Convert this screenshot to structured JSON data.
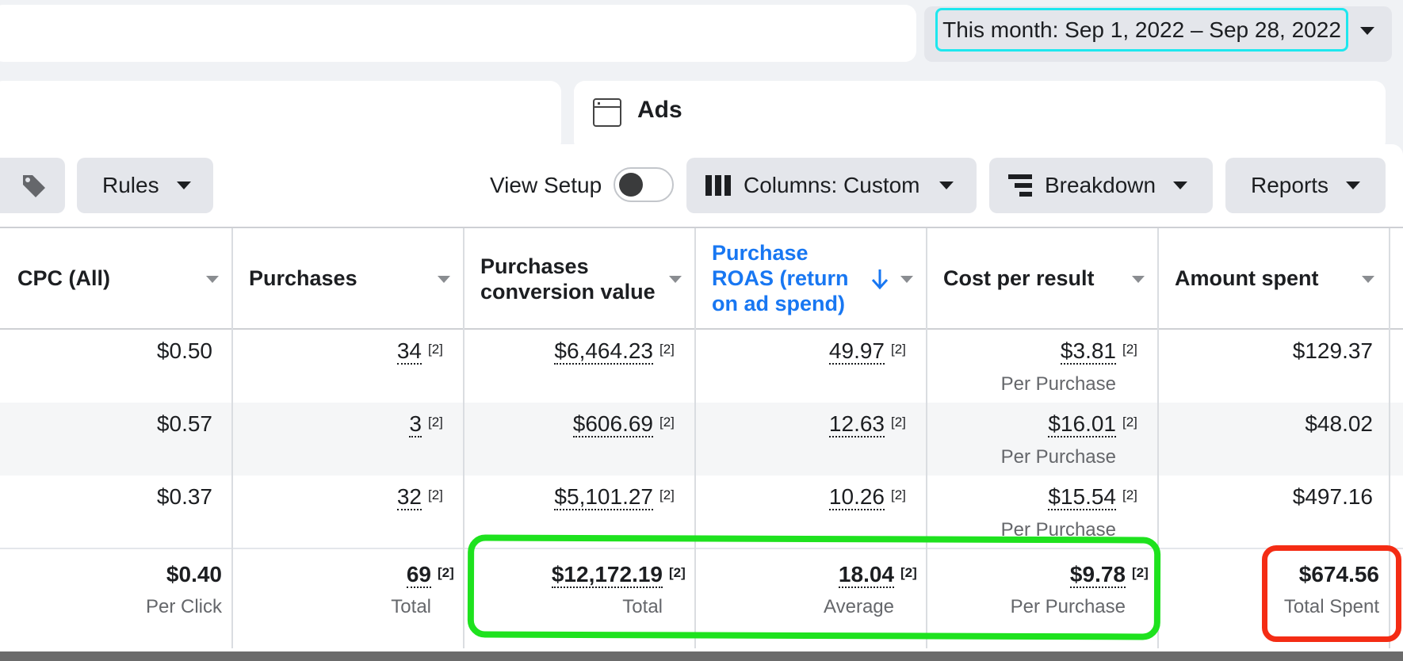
{
  "date_range": {
    "label": "This month: Sep 1, 2022 – Sep 28, 2022"
  },
  "ads_panel": {
    "title": "Ads",
    "icon": "window-icon"
  },
  "toolbar": {
    "rules_label": "Rules",
    "view_setup_label": "View Setup",
    "columns_label": "Columns: Custom",
    "breakdown_label": "Breakdown",
    "reports_label": "Reports"
  },
  "table": {
    "headers": {
      "cpc": "CPC (All)",
      "purchases": "Purchases",
      "conv_value_1": "Purchases",
      "conv_value_2": "conversion value",
      "roas_1": "Purchase",
      "roas_2": "ROAS (return",
      "roas_3": "on ad spend)",
      "cost_per_result": "Cost per result",
      "amount_spent": "Amount spent"
    },
    "note_marker": "[2]",
    "rows": [
      {
        "cpc": "$0.50",
        "purchases": "34",
        "conv_value": "$6,464.23",
        "roas": "49.97",
        "cost_per_result": "$3.81",
        "cost_sub": "Per Purchase",
        "amount_spent": "$129.37"
      },
      {
        "cpc": "$0.57",
        "purchases": "3",
        "conv_value": "$606.69",
        "roas": "12.63",
        "cost_per_result": "$16.01",
        "cost_sub": "Per Purchase",
        "amount_spent": "$48.02"
      },
      {
        "cpc": "$0.37",
        "purchases": "32",
        "conv_value": "$5,101.27",
        "roas": "10.26",
        "cost_per_result": "$15.54",
        "cost_sub": "Per Purchase",
        "amount_spent": "$497.16"
      }
    ],
    "totals": {
      "cpc": "$0.40",
      "cpc_sub": "Per Click",
      "purchases": "69",
      "purchases_sub": "Total",
      "conv_value": "$12,172.19",
      "conv_value_sub": "Total",
      "roas": "18.04",
      "roas_sub": "Average",
      "cost_per_result": "$9.78",
      "cost_sub": "Per Purchase",
      "amount_spent": "$674.56",
      "amount_sub": "Total Spent"
    }
  },
  "colors": {
    "highlight_date": "#1ee7ee",
    "highlight_group": "#1ee21e",
    "highlight_total": "#f42c14",
    "sorted_header": "#1877f2"
  }
}
